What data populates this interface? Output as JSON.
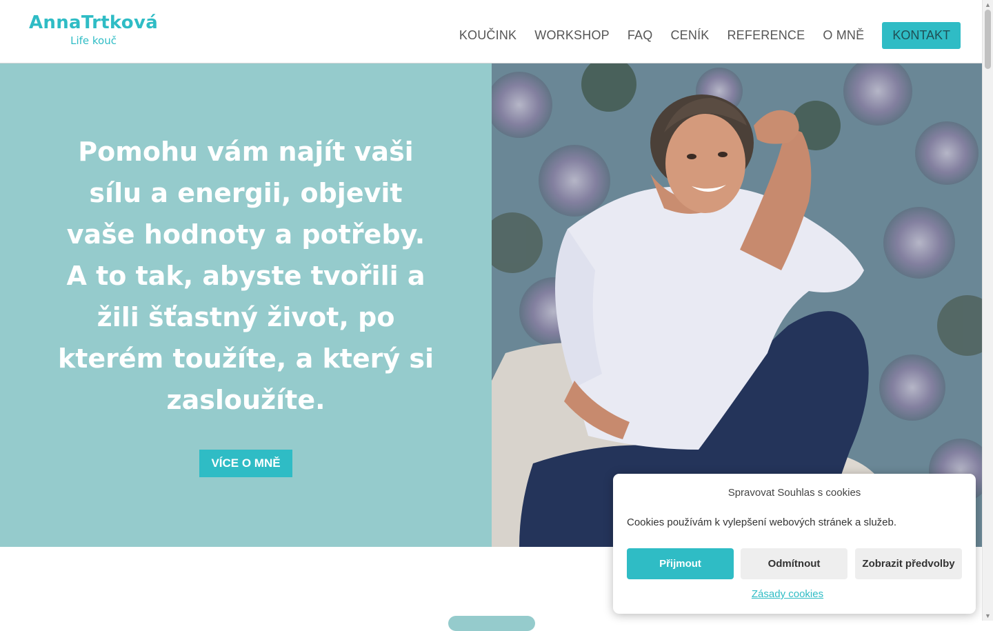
{
  "header": {
    "logo_name": "AnnaTrtková",
    "logo_sub": "Life kouč",
    "nav": [
      "KOUČINK",
      "WORKSHOP",
      "FAQ",
      "CENÍK",
      "REFERENCE",
      "O MNĚ"
    ],
    "cta": "KONTAKT"
  },
  "hero": {
    "heading": "Pomohu vám najít vaši sílu a energii, objevit vaše hodnoty a potřeby. A to tak, abyste tvořili a žili šťastný život, po kterém toužíte, a který si zasloužíte.",
    "button": "VÍCE O MNĚ"
  },
  "cookie": {
    "title": "Spravovat Souhlas s cookies",
    "message": "Cookies používám k vylepšení webových stránek a služeb.",
    "accept": "Přijmout",
    "deny": "Odmítnout",
    "prefs": "Zobrazit předvolby",
    "policy_link": "Zásady cookies"
  },
  "colors": {
    "accent": "#2fbcc5",
    "hero_bg": "#95cbcc"
  }
}
